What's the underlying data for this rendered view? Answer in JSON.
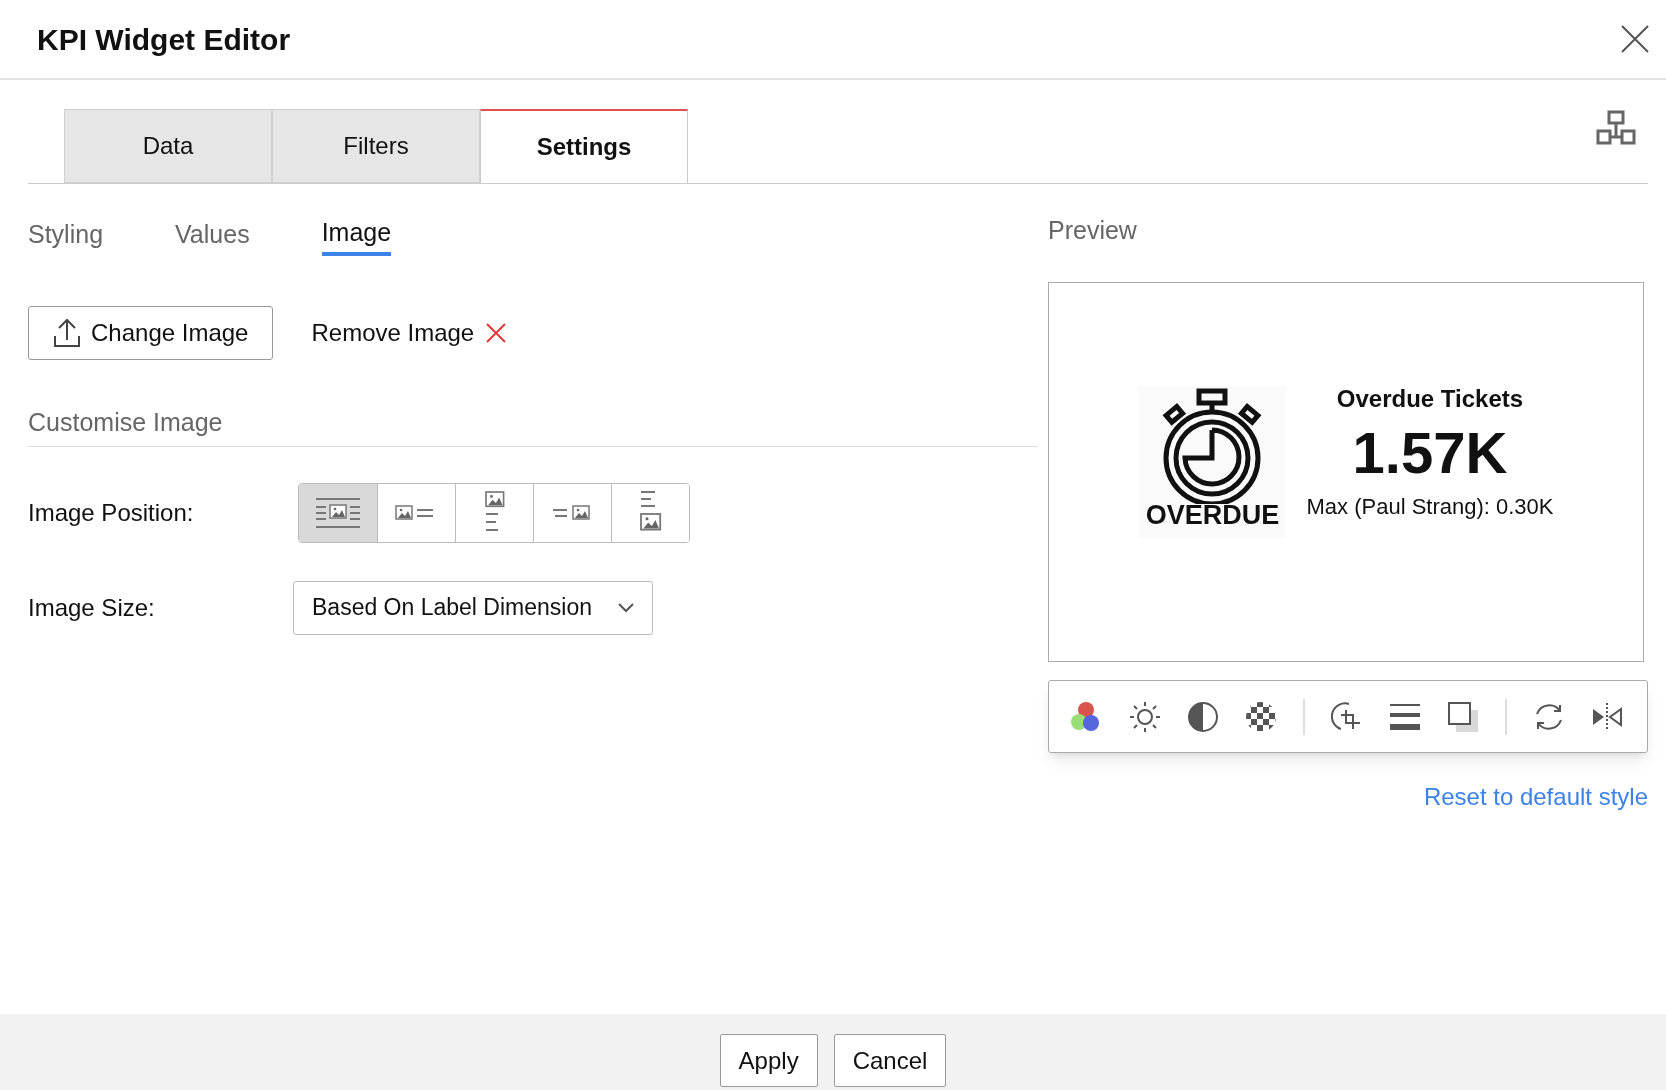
{
  "window": {
    "title": "KPI Widget Editor"
  },
  "tabs": [
    {
      "label": "Data",
      "selected": false
    },
    {
      "label": "Filters",
      "selected": false
    },
    {
      "label": "Settings",
      "selected": true
    }
  ],
  "subtabs": [
    {
      "label": "Styling",
      "selected": false
    },
    {
      "label": "Values",
      "selected": false
    },
    {
      "label": "Image",
      "selected": true
    }
  ],
  "image_actions": {
    "change": "Change Image",
    "remove": "Remove Image"
  },
  "customise": {
    "title": "Customise Image",
    "position_label": "Image Position:",
    "positions": [
      {
        "kind": "center",
        "selected": true
      },
      {
        "kind": "left",
        "selected": false
      },
      {
        "kind": "top",
        "selected": false
      },
      {
        "kind": "right",
        "selected": false
      },
      {
        "kind": "bottom",
        "selected": false
      }
    ],
    "size_label": "Image Size:",
    "size_value": "Based On Label Dimension"
  },
  "preview": {
    "title": "Preview",
    "image_caption": "OVERDUE",
    "kpi_title": "Overdue Tickets",
    "kpi_value": "1.57K",
    "kpi_sub": "Max (Paul Strang): 0.30K"
  },
  "reset_link": "Reset to default style",
  "buttons": [
    "Apply",
    "Cancel"
  ]
}
